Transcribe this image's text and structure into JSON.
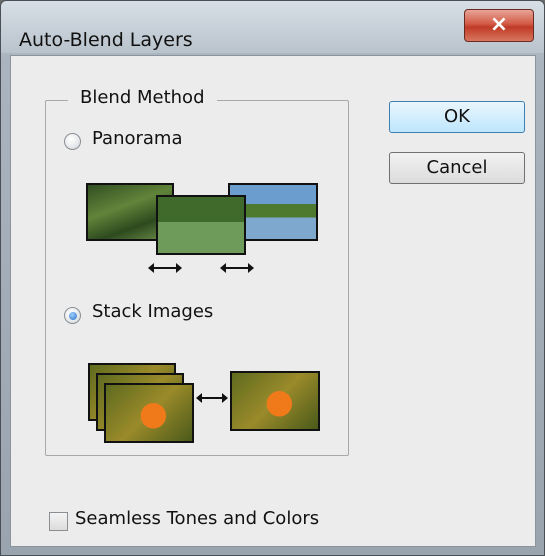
{
  "window": {
    "title": "Auto-Blend Layers",
    "close_glyph": "×"
  },
  "blend_method": {
    "legend": "Blend Method",
    "options": [
      {
        "label": "Panorama",
        "checked": false
      },
      {
        "label": "Stack Images",
        "checked": true
      }
    ]
  },
  "buttons": {
    "ok": "OK",
    "cancel": "Cancel"
  },
  "seamless": {
    "label": "Seamless Tones and Colors",
    "checked": false
  },
  "icons": [
    "close-icon",
    "panorama-illustration",
    "stack-images-illustration",
    "arrow-right-icon"
  ]
}
